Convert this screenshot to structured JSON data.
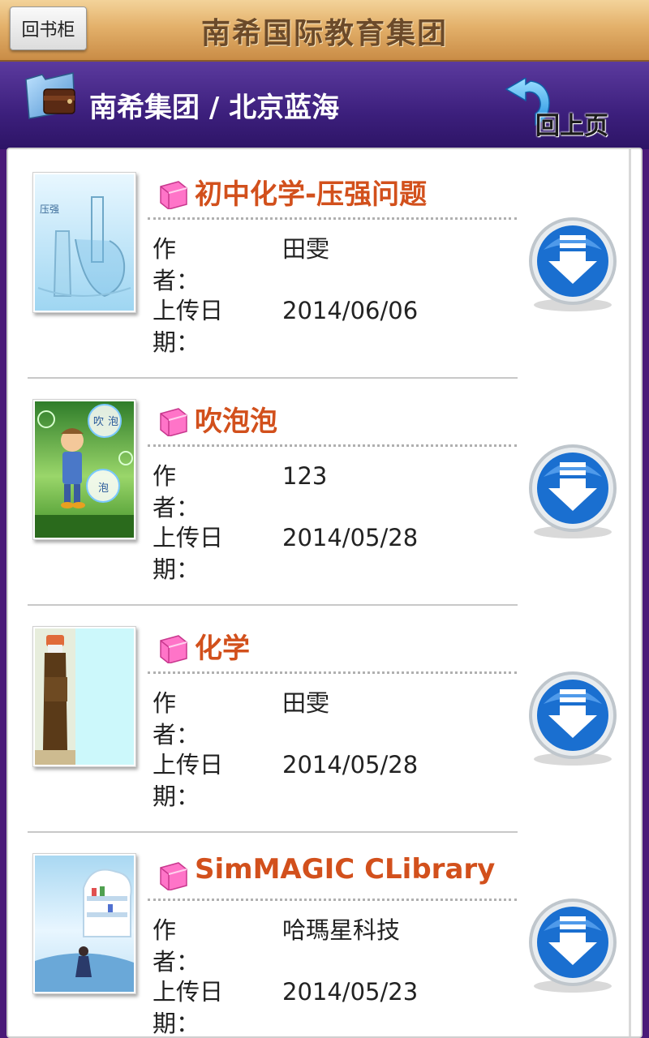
{
  "topbar": {
    "back_label": "回书柜",
    "title": "南希国际教育集团"
  },
  "navbar": {
    "breadcrumb": "南希集团 / 北京蓝海",
    "prev_label": "回上页"
  },
  "fields": {
    "author_label_1": "作",
    "author_label_2": "者：",
    "date_label_1": "上传日",
    "date_label_2": "期："
  },
  "items": [
    {
      "title": "初中化学-压强问题",
      "author": "田雯",
      "date": "2014/06/06",
      "thumb_text": "压强"
    },
    {
      "title": "吹泡泡",
      "author": "123",
      "date": "2014/05/28",
      "thumb_text_1": "吹",
      "thumb_text_2": "泡",
      "thumb_text_3": "泡"
    },
    {
      "title": "化学",
      "author": "田雯",
      "date": "2014/05/28"
    },
    {
      "title": "SimMAGIC CLibrary",
      "author": "哈瑪星科技",
      "date": "2014/05/23"
    }
  ],
  "colors": {
    "title_orange": "#d2501c",
    "header_purple": "#3c1f7c",
    "download_blue": "#1a6fd0"
  }
}
